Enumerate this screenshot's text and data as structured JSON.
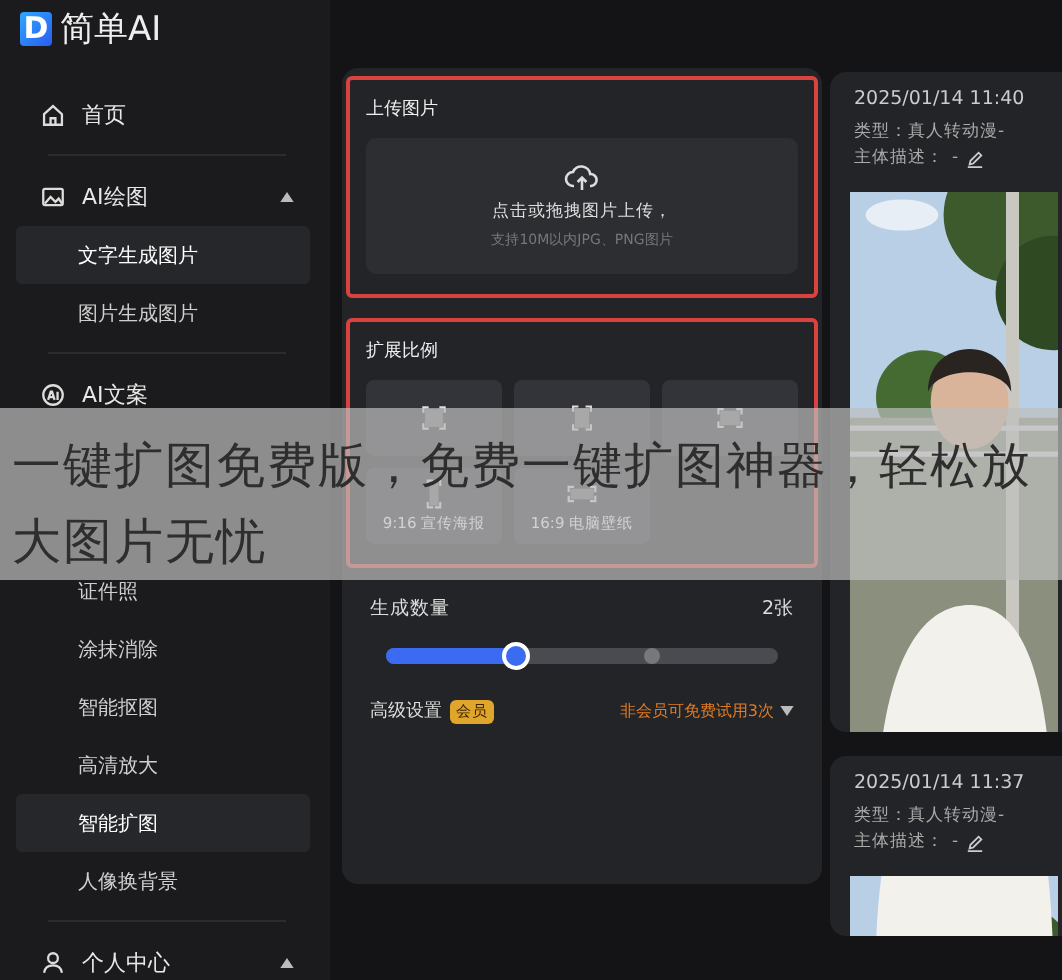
{
  "logo": {
    "mark": "D",
    "text": "简单AI"
  },
  "sidebar": {
    "items": [
      {
        "kind": "item",
        "label": "首页"
      },
      {
        "kind": "divider"
      },
      {
        "kind": "group",
        "label": "AI绘图",
        "expanded": true,
        "children": [
          {
            "label": "文字生成图片",
            "selected": true
          },
          {
            "label": "图片生成图片",
            "selected": false
          }
        ]
      },
      {
        "kind": "divider"
      },
      {
        "kind": "item",
        "label": "AI文案"
      },
      {
        "kind": "group",
        "children": [
          {
            "label": "证件照",
            "selected": false
          },
          {
            "label": "涂抹消除",
            "selected": false
          },
          {
            "label": "智能抠图",
            "selected": false
          },
          {
            "label": "高清放大",
            "selected": false
          },
          {
            "label": "智能扩图",
            "selected": true
          },
          {
            "label": "人像换背景",
            "selected": false
          }
        ]
      },
      {
        "kind": "divider"
      },
      {
        "kind": "group",
        "label": "个人中心",
        "expanded": true
      }
    ]
  },
  "upload": {
    "title": "上传图片",
    "prompt": "点击或拖拽图片上传，",
    "hint": "支持10M以内JPG、PNG图片"
  },
  "ratio": {
    "title": "扩展比例",
    "options": [
      {
        "kind": "option"
      },
      {
        "kind": "option"
      },
      {
        "kind": "option"
      },
      {
        "kind": "option",
        "label": "9:16 宣传海报"
      },
      {
        "kind": "option",
        "label": "16:9 电脑壁纸"
      }
    ]
  },
  "count": {
    "label": "生成数量",
    "value": "2张",
    "level": 0.33
  },
  "advanced": {
    "label": "高级设置",
    "badge": "会员",
    "note": "非会员可免费试用3次"
  },
  "history": [
    {
      "time": "2025/01/14 11:40",
      "type": "类型：真人转动漫-",
      "desc_label": "主体描述：",
      "desc": "-"
    },
    {
      "time": "2025/01/14 11:37",
      "type": "类型：真人转动漫-",
      "desc_label": "主体描述：",
      "desc": "-"
    }
  ],
  "caption_banner": "一键扩图免费版，免费一键扩图神器，轻松放大图片无忧"
}
